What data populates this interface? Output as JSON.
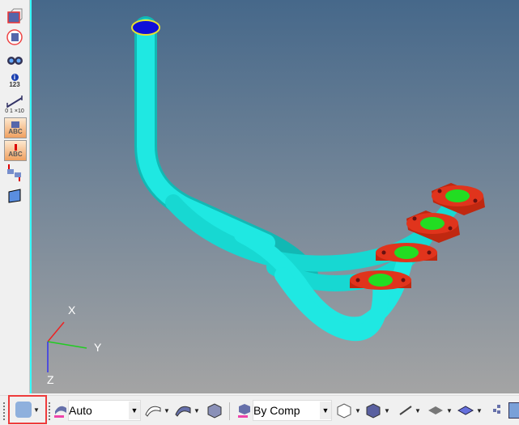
{
  "left_toolbar": {
    "items": [
      {
        "icon": "select-elements-icon"
      },
      {
        "icon": "circle-select-icon"
      },
      {
        "icon": "binoculars-find-icon"
      },
      {
        "icon": "info-123-icon",
        "label": "123"
      },
      {
        "icon": "scale-icon",
        "label": "0 1 ×10"
      },
      {
        "icon": "label-abc-icon",
        "label": "ABC"
      },
      {
        "icon": "label-abc-down-icon",
        "label": "ABC"
      },
      {
        "icon": "move-rotate-icon"
      },
      {
        "icon": "plane-icon"
      }
    ]
  },
  "axes": {
    "x": "X",
    "y": "Y",
    "z": "Z"
  },
  "bottom_toolbar": {
    "element_mode_dropdown": {
      "value": "Auto"
    },
    "color_mode_dropdown": {
      "value": "By Comp"
    }
  },
  "colors": {
    "pipe": "#19e8e0",
    "flange": "#e0341c",
    "hole": "#22dd22",
    "highlight": "#ee3b3b"
  }
}
